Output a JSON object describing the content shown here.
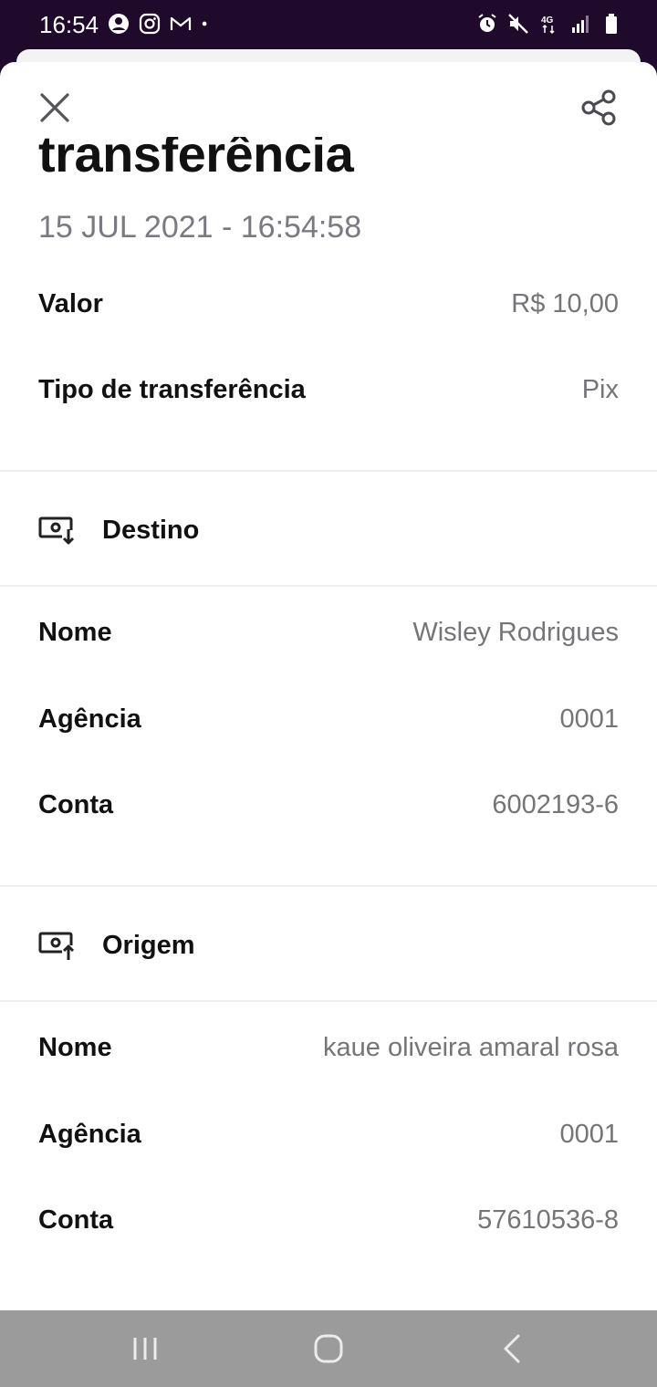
{
  "status_bar": {
    "time": "16:54",
    "left_icons": [
      "account-circle-icon",
      "instagram-icon",
      "gmail-icon",
      "notification-dot-icon"
    ],
    "right_icons": [
      "alarm-icon",
      "mute-icon",
      "network-4g-icon",
      "signal-icon",
      "battery-icon"
    ],
    "network_label": "4G"
  },
  "header": {
    "close_icon": "close-icon",
    "share_icon": "share-icon",
    "title": "transferência",
    "date": "15 JUL 2021 - 16:54:58"
  },
  "summary": [
    {
      "label": "Valor",
      "value": "R$ 10,00"
    },
    {
      "label": "Tipo de transferência",
      "value": "Pix"
    }
  ],
  "destino": {
    "title": "Destino",
    "icon": "receive-money-icon",
    "rows": [
      {
        "label": "Nome",
        "value": "Wisley Rodrigues"
      },
      {
        "label": "Agência",
        "value": "0001"
      },
      {
        "label": "Conta",
        "value": "6002193-6"
      }
    ]
  },
  "origem": {
    "title": "Origem",
    "icon": "send-money-icon",
    "rows": [
      {
        "label": "Nome",
        "value": "kaue oliveira amaral rosa"
      },
      {
        "label": "Agência",
        "value": "0001"
      },
      {
        "label": "Conta",
        "value": "57610536-8"
      }
    ]
  },
  "nav_bar": {
    "icons": [
      "recent-apps-icon",
      "home-icon",
      "back-icon"
    ]
  },
  "colors": {
    "status_bar": "#1f0a2b",
    "label_text": "#111111",
    "value_text": "#757579",
    "nav_bar": "#9b9b9b"
  }
}
